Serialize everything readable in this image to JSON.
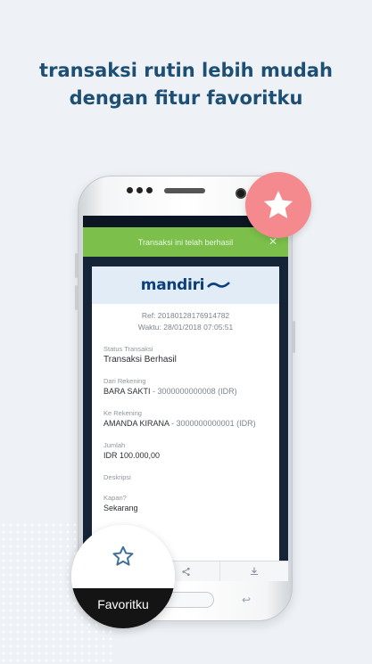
{
  "headline": {
    "line1": "transaksi rutin lebih mudah",
    "line2": "dengan fitur favoritku"
  },
  "banner": {
    "message": "Transaksi ini telah berhasil",
    "close_icon": "close-icon"
  },
  "receipt": {
    "logo": "mandiri",
    "ref": "Ref: 20180128176914782",
    "time": "Waktu: 28/01/2018 07:05:51",
    "fields": [
      {
        "label": "Status Transaksi",
        "value": "Transaksi Berhasil"
      },
      {
        "label": "Dari Rekening",
        "name": "BARA SAKTI",
        "account": " - 3000000000008 (IDR)"
      },
      {
        "label": "Ke Rekening",
        "name": "AMANDA KIRANA",
        "account": " - 3000000000001 (IDR)"
      },
      {
        "label": "Jumlah",
        "value": "IDR 100.000,00"
      },
      {
        "label": "Deskripsi",
        "value": ""
      },
      {
        "label": "Kapan?",
        "value": "Sekarang"
      }
    ]
  },
  "favorite": {
    "label": "Favoritku",
    "icon": "star-outline-icon"
  },
  "badge": {
    "icon": "star-icon",
    "color": "#f48a8d"
  },
  "colors": {
    "headline": "#1d4f74",
    "success": "#7cc04b",
    "background": "#eef2f6"
  }
}
